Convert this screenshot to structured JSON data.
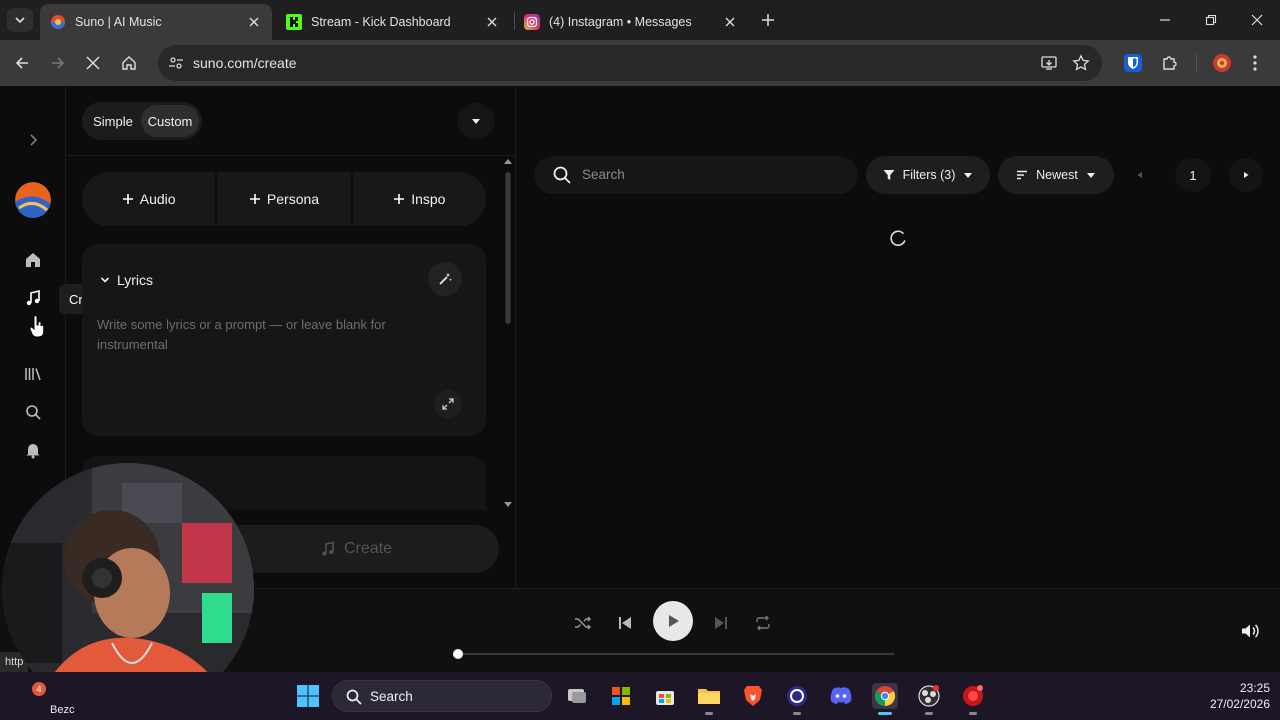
{
  "browser": {
    "tabs": [
      {
        "title": "Suno | AI Music",
        "active": true
      },
      {
        "title": "Stream - Kick Dashboard",
        "active": false
      },
      {
        "title": "(4) Instagram • Messages",
        "active": false
      }
    ],
    "url": "suno.com/create"
  },
  "rail": {
    "tooltip": "Create",
    "items": [
      "home-icon",
      "create-icon",
      "library-icon",
      "search-icon",
      "bell-icon"
    ]
  },
  "create_panel": {
    "mode_simple": "Simple",
    "mode_custom": "Custom",
    "add_buttons": [
      "Audio",
      "Persona",
      "Inspo"
    ],
    "lyrics_label": "Lyrics",
    "lyrics_placeholder": "Write some lyrics or a prompt — or leave blank for instrumental",
    "create_label": "Create"
  },
  "library": {
    "search_placeholder": "Search",
    "filters_label": "Filters (3)",
    "sort_label": "Newest",
    "page": "1"
  },
  "player": {
    "progress": 0
  },
  "status_url": "http",
  "taskbar": {
    "weather_badge": "4",
    "weather_text": "Bezc",
    "search_placeholder": "Search",
    "time": "23:25",
    "date": "27/02/2026"
  },
  "colors": {
    "app_bg": "#0c0c0c",
    "chrome_tab_bar": "#1f1f1f",
    "chrome_toolbar": "#3a3a3a",
    "taskbar_bg": "#1c1626"
  }
}
